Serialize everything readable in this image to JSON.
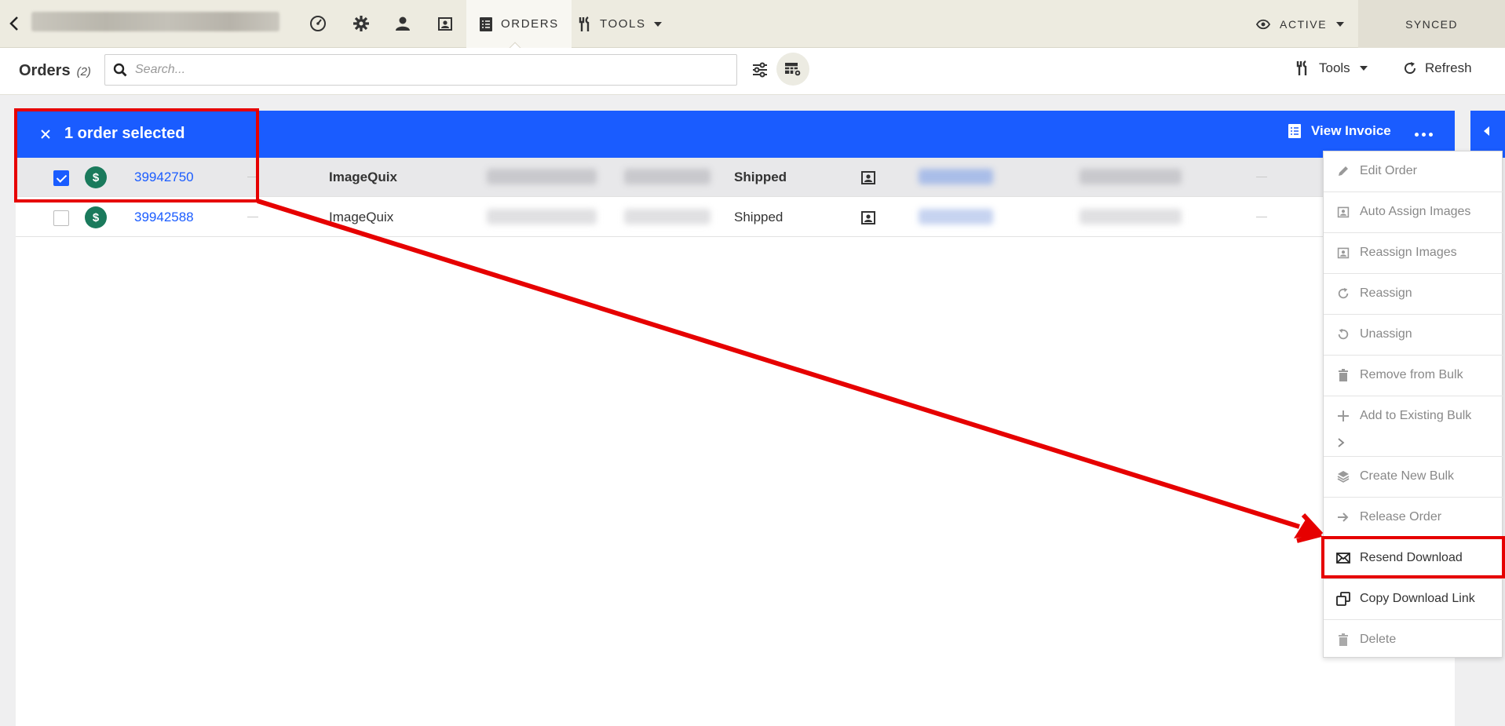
{
  "topbar": {
    "tabs": [
      {
        "label": "ORDERS",
        "active": true
      },
      {
        "label": "TOOLS",
        "active": false
      }
    ],
    "status_label": "ACTIVE",
    "sync_label": "SYNCED"
  },
  "subheader": {
    "title": "Orders",
    "count": "(2)",
    "search_placeholder": "Search...",
    "tools_label": "Tools",
    "refresh_label": "Refresh"
  },
  "selection": {
    "text": "1 order selected",
    "view_invoice_label": "View Invoice"
  },
  "orders": [
    {
      "id": "39942750",
      "source": "ImageQuix",
      "status": "Shipped",
      "selected": true
    },
    {
      "id": "39942588",
      "source": "ImageQuix",
      "status": "Shipped",
      "selected": false
    }
  ],
  "menu": {
    "items": [
      {
        "label": "Edit Order",
        "icon": "pencil-icon",
        "enabled": false
      },
      {
        "label": "Auto Assign Images",
        "icon": "image-icon",
        "enabled": false
      },
      {
        "label": "Reassign Images",
        "icon": "image-icon",
        "enabled": false
      },
      {
        "label": "Reassign",
        "icon": "redo-icon",
        "enabled": false
      },
      {
        "label": "Unassign",
        "icon": "undo-icon",
        "enabled": false
      },
      {
        "label": "Remove from Bulk",
        "icon": "trash-icon",
        "enabled": false
      },
      {
        "label": "Add to Existing Bulk",
        "icon": "plus-icon",
        "enabled": false
      },
      {
        "label": "Create New Bulk",
        "icon": "layers-icon",
        "enabled": false
      },
      {
        "label": "Release Order",
        "icon": "arrow-right-icon",
        "enabled": false
      },
      {
        "label": "Resend Download",
        "icon": "envelope-icon",
        "enabled": true
      },
      {
        "label": "Copy Download Link",
        "icon": "copy-icon",
        "enabled": true
      },
      {
        "label": "Delete",
        "icon": "trash-icon",
        "enabled": false
      }
    ]
  },
  "colors": {
    "accent": "#1a5cff",
    "annotation": "#e60000",
    "payment_badge": "#1a7a5c",
    "nav_bg": "#edebe0"
  }
}
